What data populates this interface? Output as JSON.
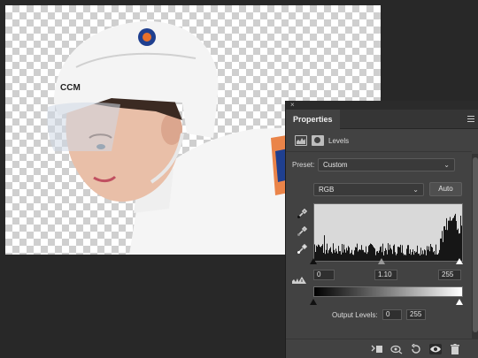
{
  "panel": {
    "collapse_glyph": "×",
    "tab_label": "Properties",
    "adjustment_title": "Levels",
    "preset_label": "Preset:",
    "preset_value": "Custom",
    "channel_value": "RGB",
    "auto_label": "Auto",
    "input_black": "0",
    "input_gamma": "1.10",
    "input_white": "255",
    "output_label": "Output Levels:",
    "output_black": "0",
    "output_white": "255"
  },
  "histogram": {
    "input_black_level": 0,
    "input_gamma": 1.1,
    "input_white_level": 255,
    "output_black_level": 0,
    "output_white_level": 255
  },
  "icons": {
    "adjustment": "levels-icon",
    "mask": "mask-icon",
    "black_point": "eyedropper-black-icon",
    "gray_point": "eyedropper-gray-icon",
    "white_point": "eyedropper-white-icon",
    "clipping_warning": "clipping-warning-icon",
    "clip_to_layer": "clip-to-layer-icon",
    "view_previous": "view-previous-icon",
    "reset": "reset-icon",
    "visibility": "eye-icon",
    "delete": "trash-icon"
  },
  "colors": {
    "workspace": "#282828",
    "panel": "#424242",
    "helmet": "#f4f4f4",
    "jersey_orange": "#e8702a",
    "jersey_blue": "#1f3f8f"
  }
}
